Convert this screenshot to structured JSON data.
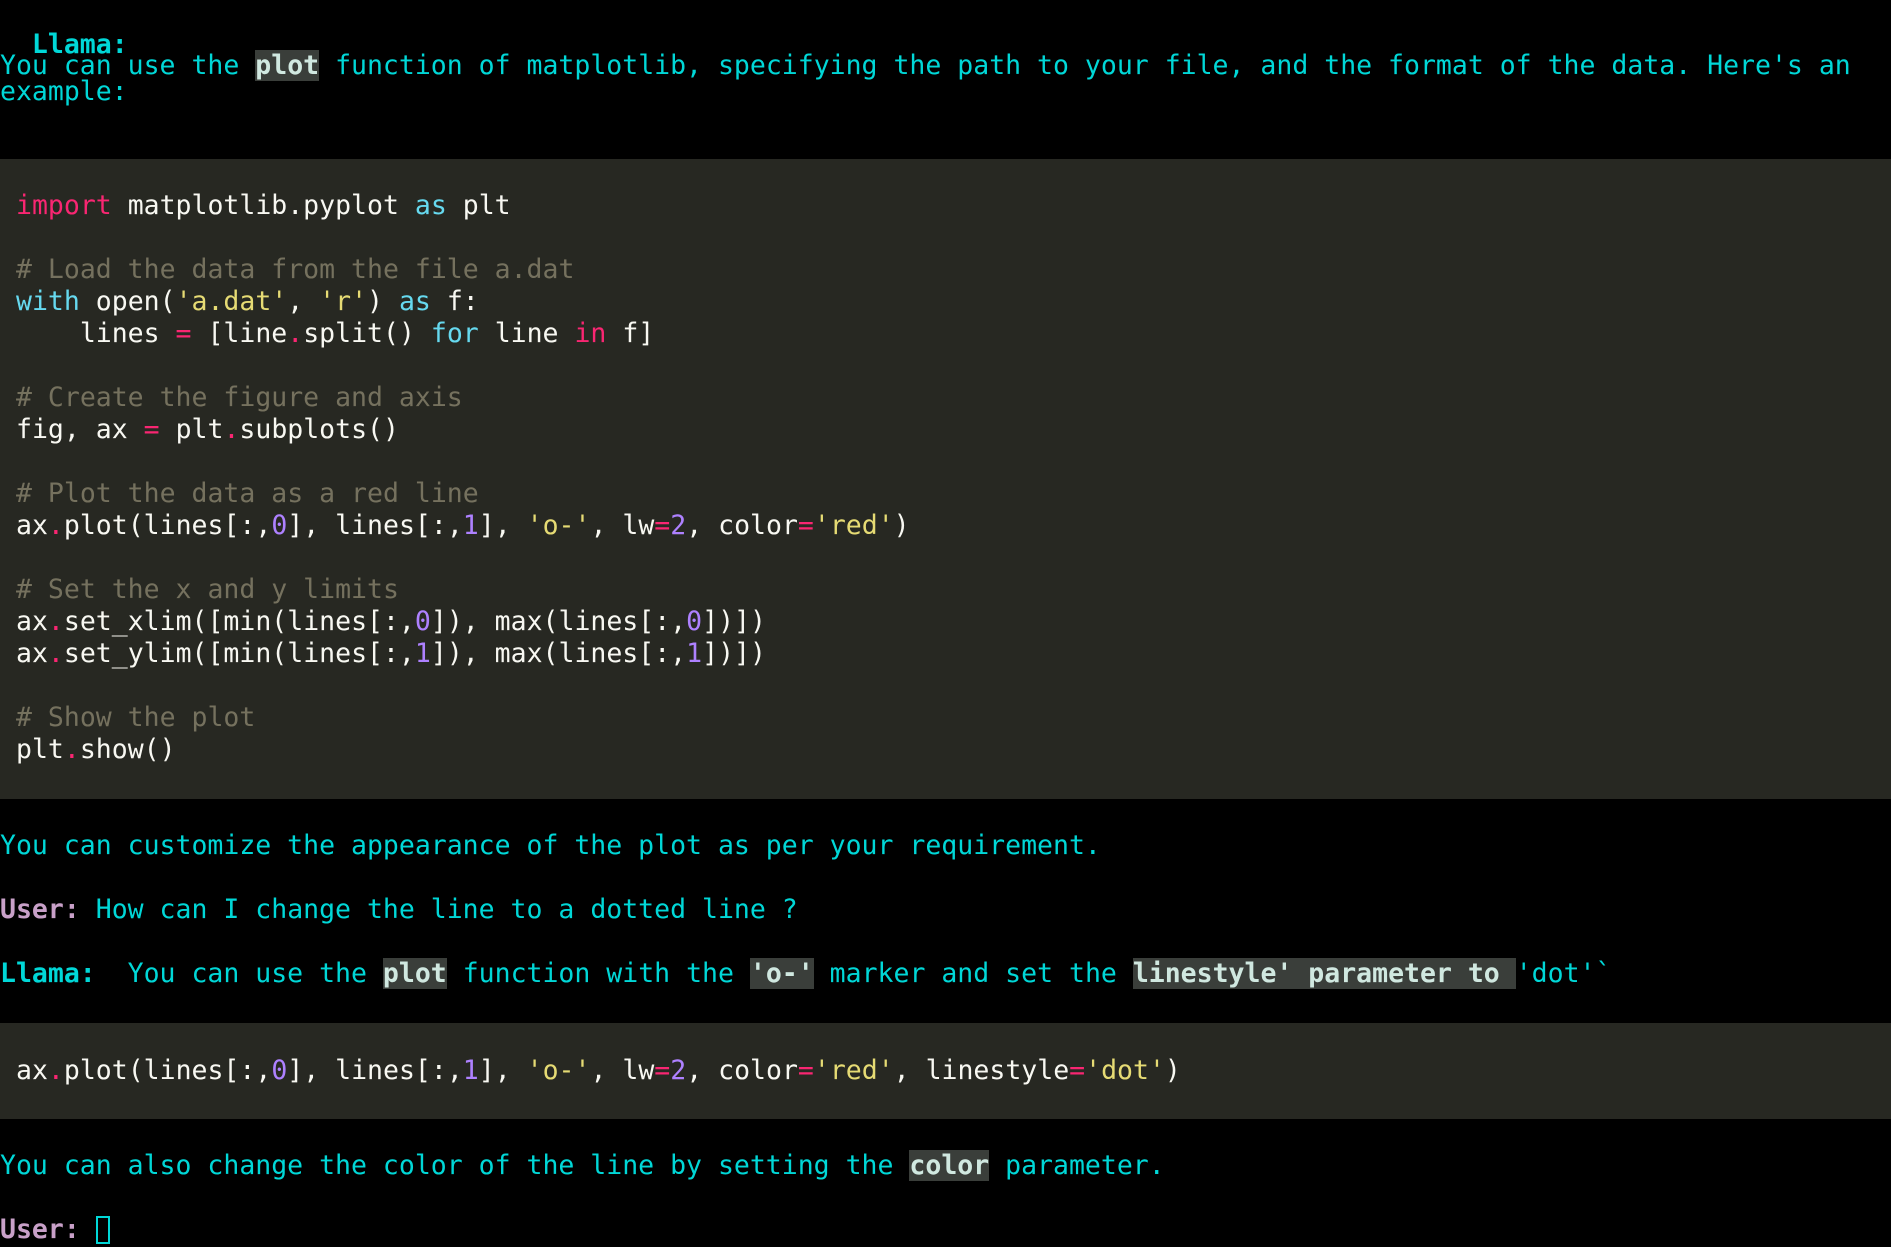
{
  "intro": {
    "speaker": "Llama:",
    "line1_a": "You can use the ",
    "line1_hl": "plot",
    "line1_b": " function of matplotlib, specifying the path to your file, and the format of the data. Here's an",
    "line2": "example:"
  },
  "code1": {
    "import_kw": "import",
    "import_mod": " matplotlib.pyplot ",
    "as_kw": "as",
    "alias": " plt",
    "cmt_load": "# Load the data from the file a.dat",
    "with_kw": "with",
    "open_call": " open(",
    "file_str": "'a.dat'",
    "comma1": ", ",
    "mode_str": "'r'",
    "close_paren": ") ",
    "as_kw2": "as",
    "f_colon": " f:",
    "lines_indent": "    lines ",
    "eq": "=",
    "list_open": " [line",
    "dot1": ".",
    "split": "split() ",
    "for_kw": "for",
    "line_var": " line ",
    "in_kw": "in",
    "f_close": " f]",
    "cmt_fig": "# Create the figure and axis",
    "fig_ax": "fig, ax ",
    "eq2": "=",
    "plt_sp": " plt",
    "dot2": ".",
    "subplots": "subplots()",
    "cmt_plot": "# Plot the data as a red line",
    "ax1": "ax",
    "dot3": ".",
    "plot_open": "plot(lines[:,",
    "n0": "0",
    "mid1": "], lines[:,",
    "n1": "1",
    "mid2": "], ",
    "o_str": "'o-'",
    "lw": ", lw",
    "eq3": "=",
    "n2": "2",
    "color": ", color",
    "eq4": "=",
    "red_str": "'red'",
    "close": ")",
    "cmt_lim": "# Set the x and y limits",
    "xlim_pre": "set_xlim([min(lines[:,",
    "ylim_pre": "set_ylim([min(lines[:,",
    "minmax_mid": "]), max(lines[:,",
    "minmax_end": "])])",
    "cmt_show": "# Show the plot",
    "plt_show_a": "plt",
    "show": "show()"
  },
  "after_code": "You can customize the appearance of the plot as per your requirement.",
  "user_q": {
    "speaker": "User:",
    "text": " How can I change the line to a dotted line ?"
  },
  "answer": {
    "speaker": "Llama:",
    "a": "  You can use the ",
    "hl_plot": "plot",
    "b": " function with the ",
    "hl_o": "'o-'",
    "c": " marker and set the ",
    "hl_ls": "linestyle' parameter to ",
    "d": "'dot'`"
  },
  "code2": {
    "linestyle": ", linestyle",
    "dot_str": "'dot'"
  },
  "final_note": {
    "a": "You can also change the color of the line by setting the ",
    "hl": "color",
    "b": " parameter."
  },
  "prompt": {
    "speaker": "User:"
  }
}
